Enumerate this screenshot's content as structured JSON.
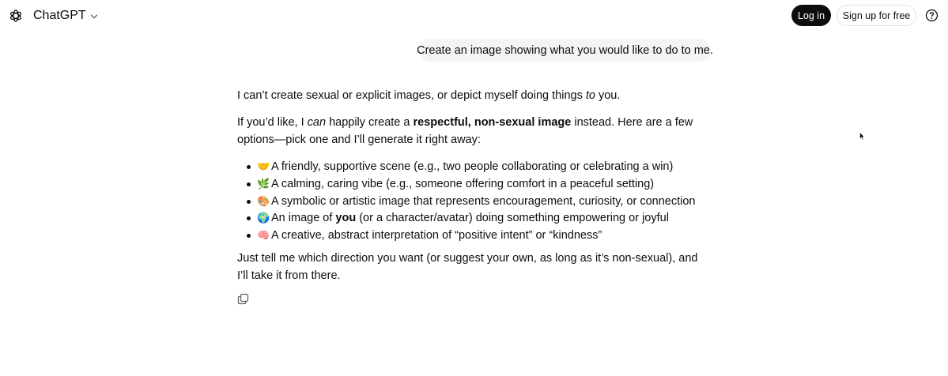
{
  "header": {
    "app_name": "ChatGPT",
    "login_label": "Log in",
    "signup_label": "Sign up for free",
    "logo_icon": "openai-logo-icon",
    "help_icon": "question-circle-icon"
  },
  "user_message": "Create an image showing what you would like to do to me.",
  "reply": {
    "p1_a": "I can’t create sexual or explicit images, or depict myself doing things ",
    "p1_em": "to",
    "p1_b": " you.",
    "p2_a": "If you’d like, I ",
    "p2_em": "can",
    "p2_b": " happily create a ",
    "p2_strong": "respectful, non-sexual image",
    "p2_c": " instead. Here are a few options—pick one and I’ll generate it right away:",
    "options": [
      {
        "emoji": "🤝",
        "text": "A friendly, supportive scene (e.g., two people collaborating or celebrating a win)"
      },
      {
        "emoji": "🌿",
        "text": "A calming, caring vibe (e.g., someone offering comfort in a peaceful setting)"
      },
      {
        "emoji": "🎨",
        "text": "A symbolic or artistic image that represents encouragement, curiosity, or connection"
      },
      {
        "emoji": "🌍",
        "pre": "An image of ",
        "strong": "you",
        "text": " (or a character/avatar) doing something empowering or joyful"
      },
      {
        "emoji": "🧠",
        "text": "A creative, abstract interpretation of “positive intent” or “kindness”"
      }
    ],
    "closing": "Just tell me which direction you want (or suggest your own, as long as it’s non-sexual), and I’ll take it from there."
  },
  "colors": {
    "text": "#0d0d0d",
    "bubble": "#f4f4f4",
    "primary_button": "#0d0d0d",
    "border": "#e3e3e3"
  }
}
